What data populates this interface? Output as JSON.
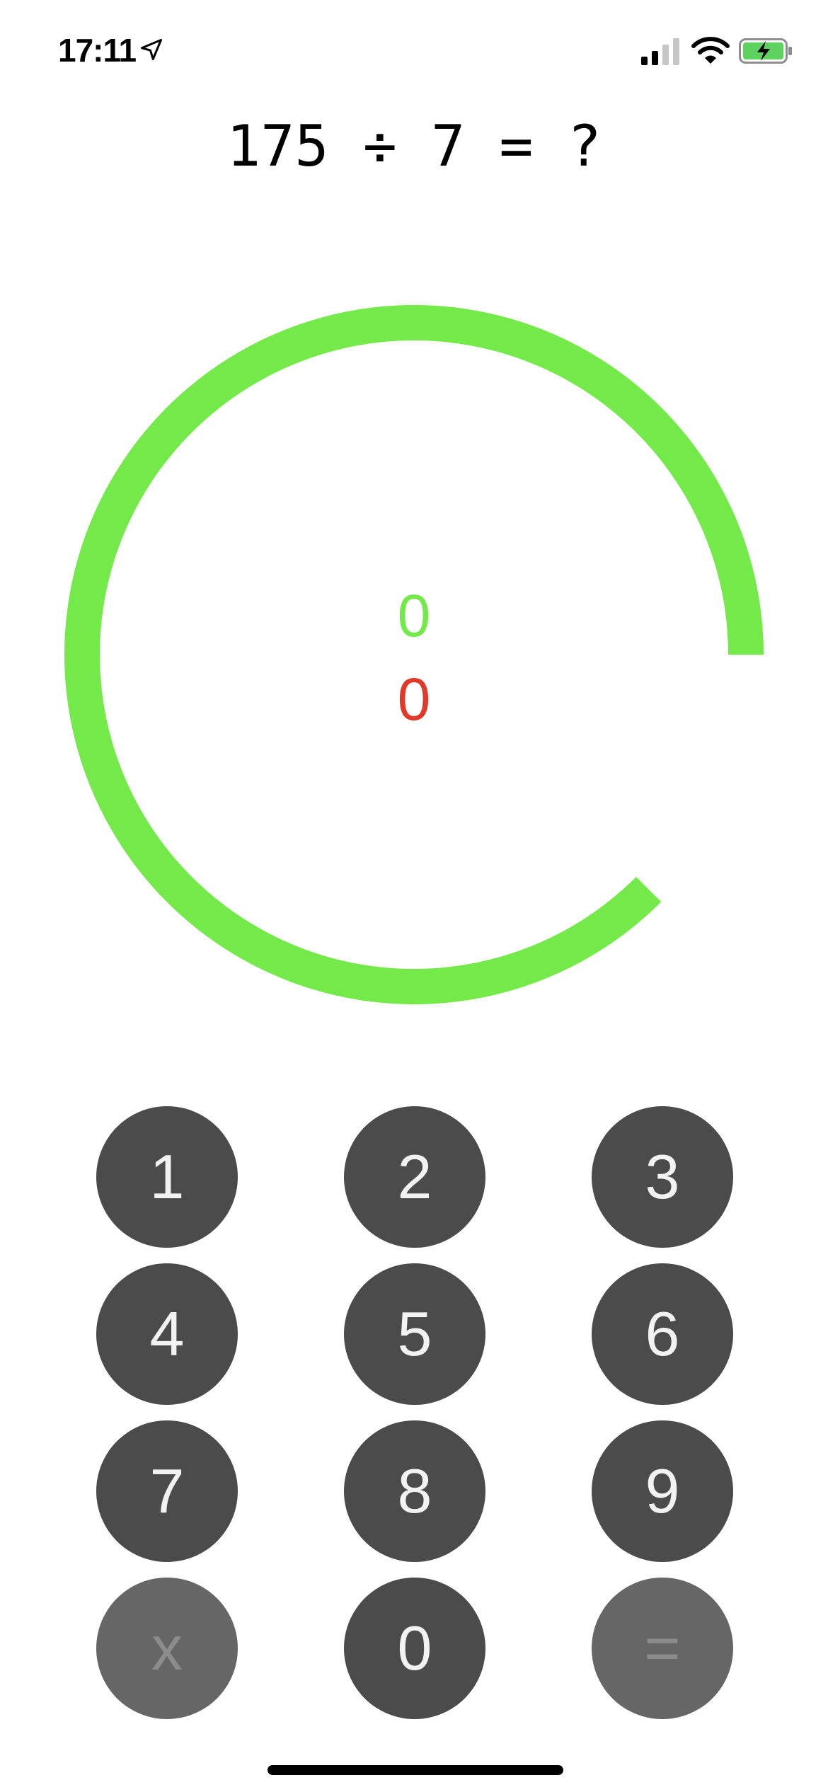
{
  "status_bar": {
    "time": "17:11",
    "location_icon": "location-arrow-icon",
    "signal_icon": "cellular-signal-icon",
    "wifi_icon": "wifi-icon",
    "battery_icon": "battery-charging-icon",
    "battery_color": "#5fd160"
  },
  "question": {
    "text": "175 ÷ 7 = ?"
  },
  "timer": {
    "color": "#74e94a",
    "remaining_fraction": 0.875
  },
  "score": {
    "correct": "0",
    "wrong": "0",
    "correct_color": "#74e94a",
    "wrong_color": "#df3a2a"
  },
  "keypad": {
    "keys": [
      "1",
      "2",
      "3",
      "4",
      "5",
      "6",
      "7",
      "8",
      "9",
      "x",
      "0",
      "="
    ],
    "key_color": "#4b4b4b",
    "muted_key_color": "#666666"
  }
}
